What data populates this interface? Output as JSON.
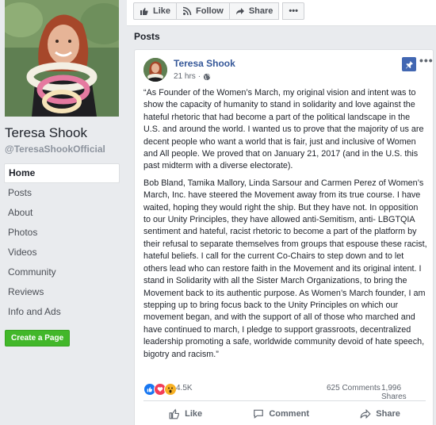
{
  "sidebar": {
    "page_name": "Teresa Shook",
    "handle": "@TeresaShookOfficial",
    "nav": [
      {
        "label": "Home",
        "active": true
      },
      {
        "label": "Posts"
      },
      {
        "label": "About"
      },
      {
        "label": "Photos"
      },
      {
        "label": "Videos"
      },
      {
        "label": "Community"
      },
      {
        "label": "Reviews"
      },
      {
        "label": "Info and Ads"
      }
    ],
    "create_page": "Create a Page"
  },
  "page_actions": {
    "like": "Like",
    "follow": "Follow",
    "share": "Share",
    "more_icon": "more-dots-icon"
  },
  "posts_heading": "Posts",
  "post": {
    "author": "Teresa Shook",
    "time": "21 hrs",
    "audience_icon": "globe-icon",
    "pinned": true,
    "paragraph1": "“As Founder of the Women’s March, my original vision and intent was to show the capacity of humanity to stand in solidarity and love against the hateful rhetoric that had become a part of the political landscape in the U.S. and around the world. I wanted us to prove that the majority of us are decent people who want a world that is fair, just and inclusive of Women and All people. We proved that on January 21, 2017 (and in the U.S. this past midterm with a diverse electorate).",
    "paragraph2": "Bob Bland, Tamika Mallory, Linda Sarsour and Carmen Perez of Women’s March, Inc. have steered the Movement away from its true course. I have waited, hoping they would right the ship. But they have not. In opposition to our Unity Principles, they have allowed anti-Semitism, anti- LBGTQIA sentiment and hateful, racist rhetoric to become a part of the platform by their refusal to separate themselves from groups that espouse these racist, hateful beliefs. I call for the current Co-Chairs to step down and to let others lead who can restore faith in the Movement and its original intent. I stand in Solidarity with all the Sister March Organizations, to bring the Movement back to its authentic purpose. As Women’s March founder, I am stepping up to bring focus back to the Unity Principles on which our movement began, and with the support of all of those who marched and have continued to march, I pledge to support grassroots, decentralized leadership promoting a safe, worldwide community devoid of hate speech, bigotry and racism.”",
    "reaction_count": "4.5K",
    "comments": "625 Comments",
    "shares": "1,996 Shares",
    "actions": {
      "like": "Like",
      "comment": "Comment",
      "share": "Share"
    }
  },
  "colors": {
    "link_blue": "#365899",
    "fb_blue": "#4267b2",
    "create_green": "#42b72a",
    "background": "#e9ebee"
  }
}
